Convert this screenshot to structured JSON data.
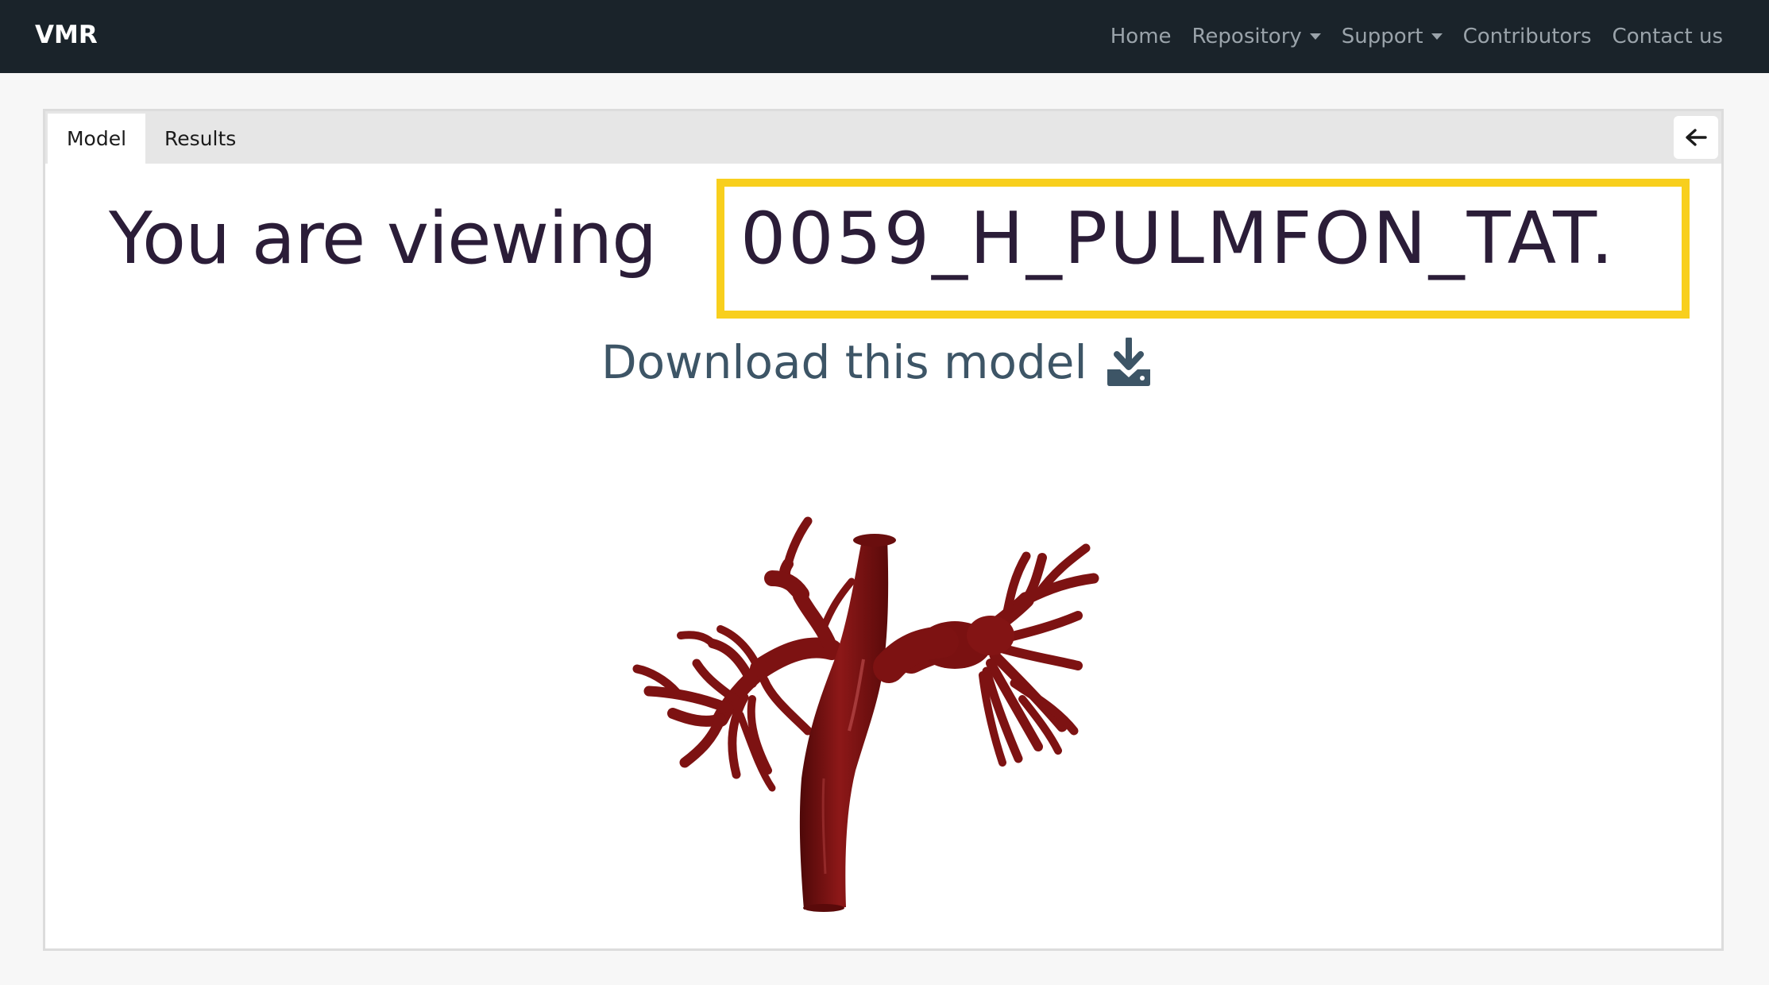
{
  "navbar": {
    "brand": "VMR",
    "links": [
      {
        "label": "Home",
        "dropdown": false
      },
      {
        "label": "Repository",
        "dropdown": true
      },
      {
        "label": "Support",
        "dropdown": true
      },
      {
        "label": "Contributors",
        "dropdown": false
      },
      {
        "label": "Contact us",
        "dropdown": false
      }
    ]
  },
  "tabs": {
    "model": "Model",
    "results": "Results",
    "active": "Model"
  },
  "back_button": {
    "icon": "arrow-left-icon"
  },
  "main": {
    "heading_prefix": "You are viewing",
    "model_id": "0059_H_PULMFON_TAT.",
    "download_label": "Download this model",
    "download_icon": "download-icon"
  },
  "colors": {
    "navbar_bg": "#1a232a",
    "highlight": "#f8cf1d",
    "heading": "#2b1d38",
    "download": "#3d5566",
    "vessel": "#7d1212"
  }
}
